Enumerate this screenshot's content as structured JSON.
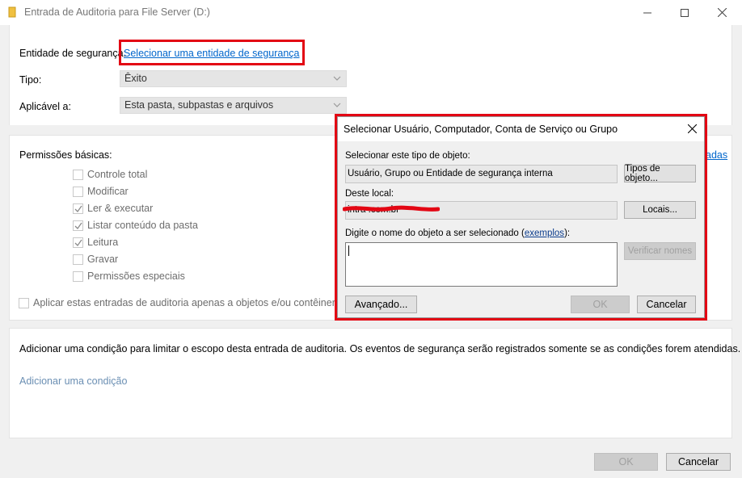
{
  "window": {
    "title": "Entrada de Auditoria para File Server (D:)",
    "icon": "folder-icon"
  },
  "form": {
    "principal_label": "Entidade de segurança:",
    "principal_link": "Selecionar uma entidade de segurança",
    "type_label": "Tipo:",
    "type_value": "Êxito",
    "applies_label": "Aplicável a:",
    "applies_value": "Esta pasta, subpastas e arquivos"
  },
  "permissions": {
    "heading": "Permissões básicas:",
    "advanced_link_fragment": "adas",
    "items": [
      {
        "label": "Controle total",
        "checked": false
      },
      {
        "label": "Modificar",
        "checked": false
      },
      {
        "label": "Ler & executar",
        "checked": true
      },
      {
        "label": "Listar conteúdo da pasta",
        "checked": true
      },
      {
        "label": "Leitura",
        "checked": true
      },
      {
        "label": "Gravar",
        "checked": false
      },
      {
        "label": "Permissões especiais",
        "checked": false
      }
    ],
    "apply_only_label": "Aplicar estas entradas de auditoria apenas a objetos e/ou contêineres de"
  },
  "condition": {
    "description": "Adicionar uma condição para limitar o escopo desta entrada de auditoria. Os eventos de segurança serão registrados somente se as condições forem atendidas.",
    "add_link": "Adicionar uma condição"
  },
  "footer": {
    "ok": "OK",
    "cancel": "Cancelar"
  },
  "dialog": {
    "title": "Selecionar Usuário, Computador, Conta de Serviço ou Grupo",
    "object_type_label": "Selecionar este tipo de objeto:",
    "object_type_value": "Usuário, Grupo ou Entidade de segurança interna",
    "object_types_button": "Tipos de objeto...",
    "location_label": "Deste local:",
    "location_value": "intra .com.br",
    "locations_button": "Locais...",
    "enter_name_label_prefix": "Digite o nome do objeto a ser selecionado (",
    "examples_link": "exemplos",
    "enter_name_label_suffix": "):",
    "check_names_button": "Verificar nomes",
    "advanced_button": "Avançado...",
    "ok_button": "OK",
    "cancel_button": "Cancelar"
  },
  "colors": {
    "highlight_red": "#e30613",
    "link_blue": "#0066cc"
  }
}
